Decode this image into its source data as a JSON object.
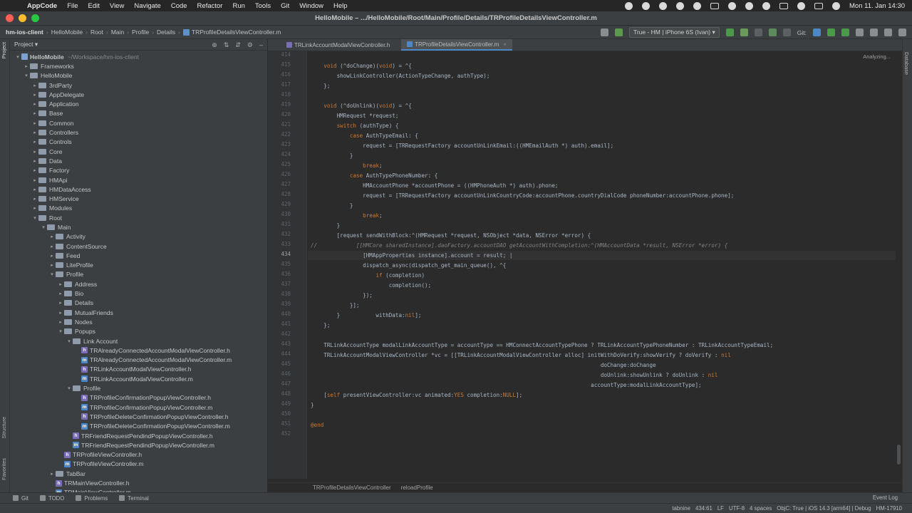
{
  "menubar": {
    "app_name": "AppCode",
    "items": [
      "File",
      "Edit",
      "View",
      "Navigate",
      "Code",
      "Refactor",
      "Run",
      "Tools",
      "Git",
      "Window",
      "Help"
    ],
    "clock": "Mon 11. Jan  14:30"
  },
  "window": {
    "title": "HelloMobile – .../HelloMobile/Root/Main/Profile/Details/TRProfileDetailsViewController.m"
  },
  "navbar": {
    "crumbs": [
      "hm-ios-client",
      "HelloMobile",
      "Root",
      "Main",
      "Profile",
      "Details"
    ],
    "file": "TRProfileDetailsViewController.m",
    "run_config": "True - HM | iPhone 6S (Ivan) ▾",
    "git_label": "Git:"
  },
  "sidebar": {
    "tab_project": "Project",
    "tab_structure": "Structure",
    "tab_favorites": "Favorites",
    "panel_title": "Project ▾",
    "tree": [
      {
        "indent": 0,
        "arrow": "▾",
        "kind": "project",
        "label": "HelloMobile",
        "muted": "~/Workspace/hm-ios-client"
      },
      {
        "indent": 1,
        "arrow": "▸",
        "kind": "folder",
        "label": "Frameworks"
      },
      {
        "indent": 1,
        "arrow": "▾",
        "kind": "folder",
        "label": "HelloMobile"
      },
      {
        "indent": 2,
        "arrow": "▸",
        "kind": "folder",
        "label": "3rdParty"
      },
      {
        "indent": 2,
        "arrow": "▸",
        "kind": "folder",
        "label": "AppDelegate"
      },
      {
        "indent": 2,
        "arrow": "▸",
        "kind": "folder",
        "label": "Application"
      },
      {
        "indent": 2,
        "arrow": "▸",
        "kind": "folder",
        "label": "Base"
      },
      {
        "indent": 2,
        "arrow": "▸",
        "kind": "folder",
        "label": "Common"
      },
      {
        "indent": 2,
        "arrow": "▸",
        "kind": "folder",
        "label": "Controllers"
      },
      {
        "indent": 2,
        "arrow": "▸",
        "kind": "folder",
        "label": "Controls"
      },
      {
        "indent": 2,
        "arrow": "▸",
        "kind": "folder",
        "label": "Core"
      },
      {
        "indent": 2,
        "arrow": "▸",
        "kind": "folder",
        "label": "Data"
      },
      {
        "indent": 2,
        "arrow": "▸",
        "kind": "folder",
        "label": "Factory"
      },
      {
        "indent": 2,
        "arrow": "▸",
        "kind": "folder",
        "label": "HMApi"
      },
      {
        "indent": 2,
        "arrow": "▸",
        "kind": "folder",
        "label": "HMDataAccess"
      },
      {
        "indent": 2,
        "arrow": "▸",
        "kind": "folder",
        "label": "HMService"
      },
      {
        "indent": 2,
        "arrow": "▸",
        "kind": "folder",
        "label": "Modules"
      },
      {
        "indent": 2,
        "arrow": "▾",
        "kind": "folder",
        "label": "Root"
      },
      {
        "indent": 3,
        "arrow": "▾",
        "kind": "folder",
        "label": "Main"
      },
      {
        "indent": 4,
        "arrow": "▸",
        "kind": "folder",
        "label": "Activity"
      },
      {
        "indent": 4,
        "arrow": "▸",
        "kind": "folder",
        "label": "ContentSource"
      },
      {
        "indent": 4,
        "arrow": "▸",
        "kind": "folder",
        "label": "Feed"
      },
      {
        "indent": 4,
        "arrow": "▸",
        "kind": "folder",
        "label": "LiteProfile"
      },
      {
        "indent": 4,
        "arrow": "▾",
        "kind": "folder",
        "label": "Profile"
      },
      {
        "indent": 5,
        "arrow": "▸",
        "kind": "folder",
        "label": "Address"
      },
      {
        "indent": 5,
        "arrow": "▸",
        "kind": "folder",
        "label": "Bio"
      },
      {
        "indent": 5,
        "arrow": "▸",
        "kind": "folder",
        "label": "Details"
      },
      {
        "indent": 5,
        "arrow": "▸",
        "kind": "folder",
        "label": "MutualFriends"
      },
      {
        "indent": 5,
        "arrow": "▸",
        "kind": "folder",
        "label": "Nodes"
      },
      {
        "indent": 5,
        "arrow": "▾",
        "kind": "folder",
        "label": "Popups"
      },
      {
        "indent": 6,
        "arrow": "▾",
        "kind": "folder",
        "label": "Link Account"
      },
      {
        "indent": 7,
        "arrow": "",
        "kind": "h",
        "label": "TRAlreadyConnectedAccountModalViewController.h"
      },
      {
        "indent": 7,
        "arrow": "",
        "kind": "m",
        "label": "TRAlreadyConnectedAccountModalViewController.m"
      },
      {
        "indent": 7,
        "arrow": "",
        "kind": "h",
        "label": "TRLinkAccountModalViewController.h"
      },
      {
        "indent": 7,
        "arrow": "",
        "kind": "m",
        "label": "TRLinkAccountModalViewController.m"
      },
      {
        "indent": 6,
        "arrow": "▾",
        "kind": "folder",
        "label": "Profile"
      },
      {
        "indent": 7,
        "arrow": "",
        "kind": "h",
        "label": "TRProfileConfirmationPopupViewController.h"
      },
      {
        "indent": 7,
        "arrow": "",
        "kind": "m",
        "label": "TRProfileConfirmationPopupViewController.m"
      },
      {
        "indent": 7,
        "arrow": "",
        "kind": "h",
        "label": "TRProfileDeleteConfirmationPopupViewController.h"
      },
      {
        "indent": 7,
        "arrow": "",
        "kind": "m",
        "label": "TRProfileDeleteConfirmationPopupViewController.m"
      },
      {
        "indent": 6,
        "arrow": "",
        "kind": "h",
        "label": "TRFriendRequestPendindPopupViewController.h"
      },
      {
        "indent": 6,
        "arrow": "",
        "kind": "m",
        "label": "TRFriendRequestPendindPopupViewController.m"
      },
      {
        "indent": 5,
        "arrow": "",
        "kind": "h",
        "label": "TRProfileViewController.h"
      },
      {
        "indent": 5,
        "arrow": "",
        "kind": "m",
        "label": "TRProfileViewController.m"
      },
      {
        "indent": 4,
        "arrow": "▸",
        "kind": "folder",
        "label": "TabBar"
      },
      {
        "indent": 4,
        "arrow": "",
        "kind": "h",
        "label": "TRMainViewController.h"
      },
      {
        "indent": 4,
        "arrow": "",
        "kind": "m",
        "label": "TRMainViewController.m"
      }
    ]
  },
  "editor": {
    "tabs": [
      {
        "label": "TRLinkAccountModalViewController.h",
        "kind": "h",
        "active": false
      },
      {
        "label": "TRProfileDetailsViewController.m",
        "kind": "m",
        "active": true
      }
    ],
    "status_hint": "Analyzing...",
    "current_line": 434,
    "lines": [
      {
        "n": 414,
        "html": ""
      },
      {
        "n": 415,
        "html": "    <span class='kw'>void</span> (^doChange)(<span class='kw'>void</span>) = ^{"
      },
      {
        "n": 416,
        "html": "        showLinkController(ActionTypeChange, authType);"
      },
      {
        "n": 417,
        "html": "    };"
      },
      {
        "n": 418,
        "html": ""
      },
      {
        "n": 419,
        "html": "    <span class='kw'>void</span> (^doUnlink)(<span class='kw'>void</span>) = ^{"
      },
      {
        "n": 420,
        "html": "        HMRequest *request;"
      },
      {
        "n": 421,
        "html": "        <span class='kw'>switch</span> (authType) {"
      },
      {
        "n": 422,
        "html": "            <span class='kw'>case</span> AuthTypeEmail: {"
      },
      {
        "n": 423,
        "html": "                request = [TRRequestFactory accountUnLinkEmail:((HMEmailAuth *) auth).email];"
      },
      {
        "n": 424,
        "html": "            }"
      },
      {
        "n": 425,
        "html": "                <span class='kw'>break</span>;"
      },
      {
        "n": 426,
        "html": "            <span class='kw'>case</span> AuthTypePhoneNumber: {"
      },
      {
        "n": 427,
        "html": "                HMAccountPhone *accountPhone = ((HMPhoneAuth *) auth).phone;"
      },
      {
        "n": 428,
        "html": "                request = [TRRequestFactory accountUnLinkCountryCode:accountPhone.countryDialCode phoneNumber:accountPhone.phone];"
      },
      {
        "n": 429,
        "html": "            }"
      },
      {
        "n": 430,
        "html": "                <span class='kw'>break</span>;"
      },
      {
        "n": 431,
        "html": "        }"
      },
      {
        "n": 432,
        "html": "        [request sendWithBlock:^(HMRequest *request, NSObject *data, NSError *error) {"
      },
      {
        "n": 433,
        "html": "<span class='cm'>//            [[HMCore sharedInstance].daoFactory.accountDAO getAccountWithCompletion:^(HMAccountData *result, NSError *error) {</span>"
      },
      {
        "n": 434,
        "html": "                [HMAppProperties instance].account = result; |"
      },
      {
        "n": 435,
        "html": "                dispatch_async(dispatch_get_main_queue(), ^{"
      },
      {
        "n": 436,
        "html": "                    <span class='kw'>if</span> (completion)"
      },
      {
        "n": 437,
        "html": "                        completion();"
      },
      {
        "n": 438,
        "html": "                });"
      },
      {
        "n": 439,
        "html": "            }];"
      },
      {
        "n": 440,
        "html": "        }           withData:<span class='kw'>nil</span>];"
      },
      {
        "n": 441,
        "html": "    };"
      },
      {
        "n": 442,
        "html": ""
      },
      {
        "n": 443,
        "html": "    TRLinkAccountType modalLinkAccountType = accountType == HMConnectAccountTypePhone ? TRLinkAccountTypePhoneNumber : TRLinkAccountTypeEmail;"
      },
      {
        "n": 444,
        "html": "    TRLinkAccountModalViewController *vc = [[TRLinkAccountModalViewController alloc] initWithDoVerify:showVerify ? doVerify : <span class='kw'>nil</span>"
      },
      {
        "n": 445,
        "html": "                                                                                         doChange:doChange"
      },
      {
        "n": 446,
        "html": "                                                                                         doUnlink:showUnlink ? doUnlink : <span class='kw'>nil</span>"
      },
      {
        "n": 447,
        "html": "                                                                                      accountType:modalLinkAccountType];"
      },
      {
        "n": 448,
        "html": "    [<span class='kw'>self</span> presentViewController:vc animated:<span class='kw'>YES</span> completion:<span class='kw'>NULL</span>];"
      },
      {
        "n": 449,
        "html": "}"
      },
      {
        "n": 450,
        "html": ""
      },
      {
        "n": 451,
        "html": "<span class='kw'>@end</span>"
      },
      {
        "n": 452,
        "html": ""
      }
    ],
    "breadcrumb": [
      "TRProfileDetailsViewController",
      "reloadProfile"
    ]
  },
  "right_strip": {
    "label": "Database"
  },
  "bottom_tools": [
    "Git",
    "TODO",
    "Problems",
    "Terminal"
  ],
  "event_log": "Event Log",
  "status": [
    "tabnine",
    "434:61",
    "LF",
    "UTF-8",
    "4 spaces",
    "ObjC: True | iOS 14.3 [arm64] | Debug",
    "HM-17910"
  ],
  "colors": {
    "accent": "#4a88c7",
    "keyword": "#cc7832",
    "comment": "#808080"
  }
}
